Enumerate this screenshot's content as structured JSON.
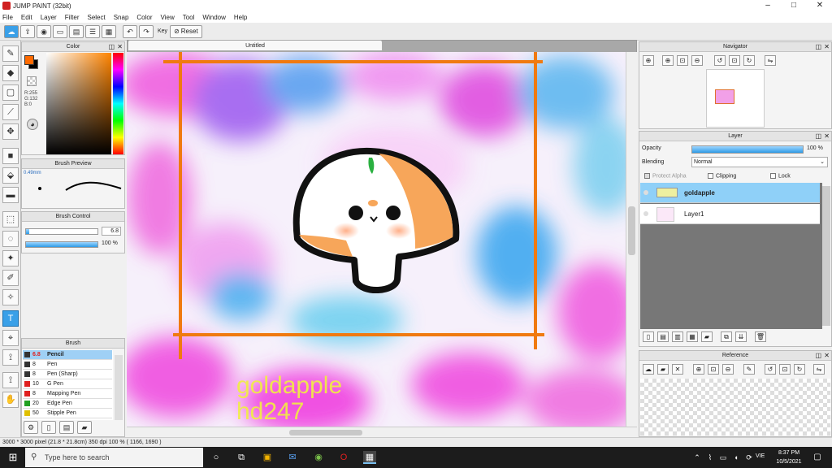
{
  "window": {
    "title": "JUMP PAINT (32bit)",
    "minimize": "–",
    "maximize": "□",
    "close": "✕"
  },
  "menu": [
    "File",
    "Edit",
    "Layer",
    "Filter",
    "Select",
    "Snap",
    "Color",
    "View",
    "Tool",
    "Window",
    "Help"
  ],
  "toolbar": {
    "key_label": "Key",
    "reset_label": "Reset"
  },
  "color_panel": {
    "title": "Color",
    "readout_r": "R:255",
    "readout_g": "G:132",
    "readout_b": "B:0",
    "foreground": "#ff6a00",
    "background": "#000000"
  },
  "brush_preview": {
    "title": "Brush Preview",
    "size_label": "0.49mm"
  },
  "brush_control": {
    "title": "Brush Control",
    "size_value": "6.8",
    "opacity_value": "100 %",
    "size_fraction": 0.05,
    "opacity_fraction": 1.0
  },
  "brush_panel": {
    "title": "Brush",
    "items": [
      {
        "size": "6.8",
        "name": "Pencil",
        "color": "#333333"
      },
      {
        "size": "8",
        "name": "Pen",
        "color": "#333333"
      },
      {
        "size": "8",
        "name": "Pen (Sharp)",
        "color": "#333333"
      },
      {
        "size": "10",
        "name": "G Pen",
        "color": "#e02020"
      },
      {
        "size": "8",
        "name": "Mapping Pen",
        "color": "#e02020"
      },
      {
        "size": "20",
        "name": "Edge Pen",
        "color": "#20a020"
      },
      {
        "size": "50",
        "name": "Stipple Pen",
        "color": "#e0c000"
      }
    ]
  },
  "document": {
    "tab_title": "Untitled",
    "watermark_line1": "goldapple",
    "watermark_line2": "hd247"
  },
  "navigator": {
    "title": "Navigator"
  },
  "layer_panel": {
    "title": "Layer",
    "opacity_label": "Opacity",
    "opacity_value": "100 %",
    "opacity_fraction": 1.0,
    "blending_label": "Blending",
    "blending_value": "Normal",
    "protect_alpha": "Protect Alpha",
    "clipping": "Clipping",
    "lock": "Lock",
    "layers": [
      {
        "name": "goldapple",
        "selected": true
      },
      {
        "name": "Layer1",
        "selected": false
      }
    ]
  },
  "reference": {
    "title": "Reference"
  },
  "status": {
    "text": "3000 * 3000 pixel   (21.8 * 21.8cm)   350 dpi   100 %   ( 1166, 1690 )"
  },
  "taskbar": {
    "search_placeholder": "Type here to search",
    "time": "8:37 PM",
    "date": "10/5/2021",
    "lang": "VIE"
  }
}
